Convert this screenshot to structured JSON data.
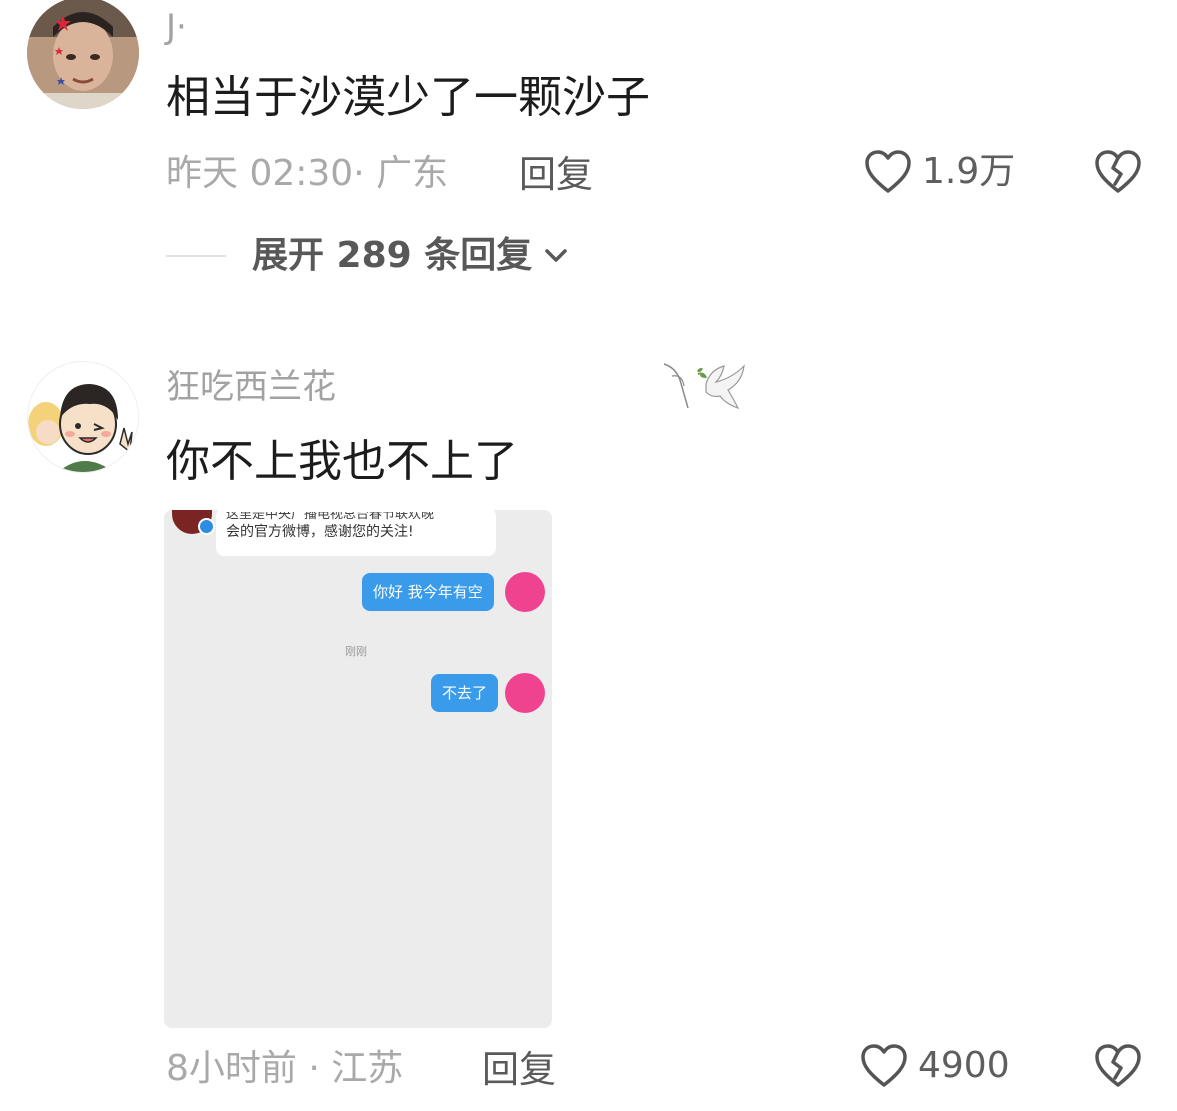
{
  "comments": [
    {
      "username": "J·",
      "text": "相当于沙漠少了一颗沙子",
      "time_location": "昨天 02:30· 广东",
      "reply_label": "回复",
      "likes": "1.9万",
      "expand_label": "展开 289 条回复",
      "avatar_icon": "user-avatar-photo",
      "like_icon": "heart-outline-icon",
      "dislike_icon": "broken-heart-icon"
    },
    {
      "username": "狂吃西兰花",
      "text": "你不上我也不上了",
      "time_location": "8小时前 · 江苏",
      "reply_label": "回复",
      "likes": "4900",
      "avatar_icon": "cartoon-avatar",
      "badge_icon": "dove-with-olive-branch-icon",
      "like_icon": "heart-outline-icon",
      "dislike_icon": "broken-heart-icon",
      "attachment": {
        "top_message_line1": "这里是中央广播电视总台春节联欢晚",
        "top_message_line2": "会的官方微博，感谢您的关注!",
        "bubble1": "你好 我今年有空",
        "timestamp": "刚刚",
        "bubble2": "不去了"
      }
    }
  ],
  "colors": {
    "username": "#a2a2a2",
    "text": "#1c1c1c",
    "meta": "#a9a9a9",
    "bubble": "#3a9bea",
    "pink_avatar": "#f0438f",
    "chat_bg": "#ececed"
  }
}
